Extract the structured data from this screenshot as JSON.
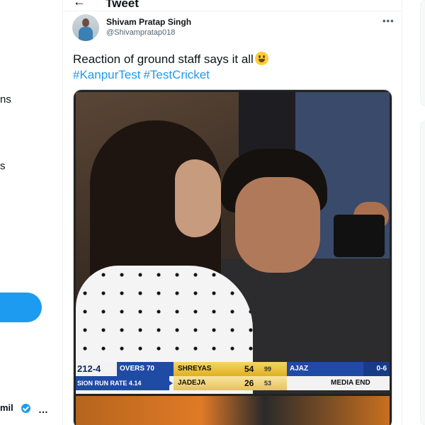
{
  "nav": {
    "fragment_1": "ns",
    "fragment_2": "s",
    "account_name_fragment": "mil",
    "account_more": "…",
    "verified_icon": "verified-badge-icon"
  },
  "header": {
    "back_icon": "←",
    "title": "Tweet"
  },
  "tweet": {
    "author_name": "Shivam Pratap Singh",
    "author_handle": "@Shivampratap018",
    "more_icon": "•••",
    "text": "Reaction of ground staff says it all",
    "emoji": "grinning-face-emoji",
    "hashtags": [
      "#KanpurTest",
      "#TestCricket"
    ]
  },
  "scoreboard": {
    "team_total": "212-4",
    "overs": "OVERS 70",
    "run_rate": "SION RUN RATE 4.14",
    "batter1": {
      "name": "SHREYAS",
      "runs": "54",
      "balls": "99"
    },
    "batter2": {
      "name": "JADEJA",
      "runs": "26",
      "balls": "53"
    },
    "bowler": "AJAZ",
    "bowler_figures": "0-6",
    "end": "MEDIA END"
  },
  "colors": {
    "accent": "#1d9bf0",
    "score_blue": "#1f4ba5",
    "score_gold": "#e0b020"
  }
}
